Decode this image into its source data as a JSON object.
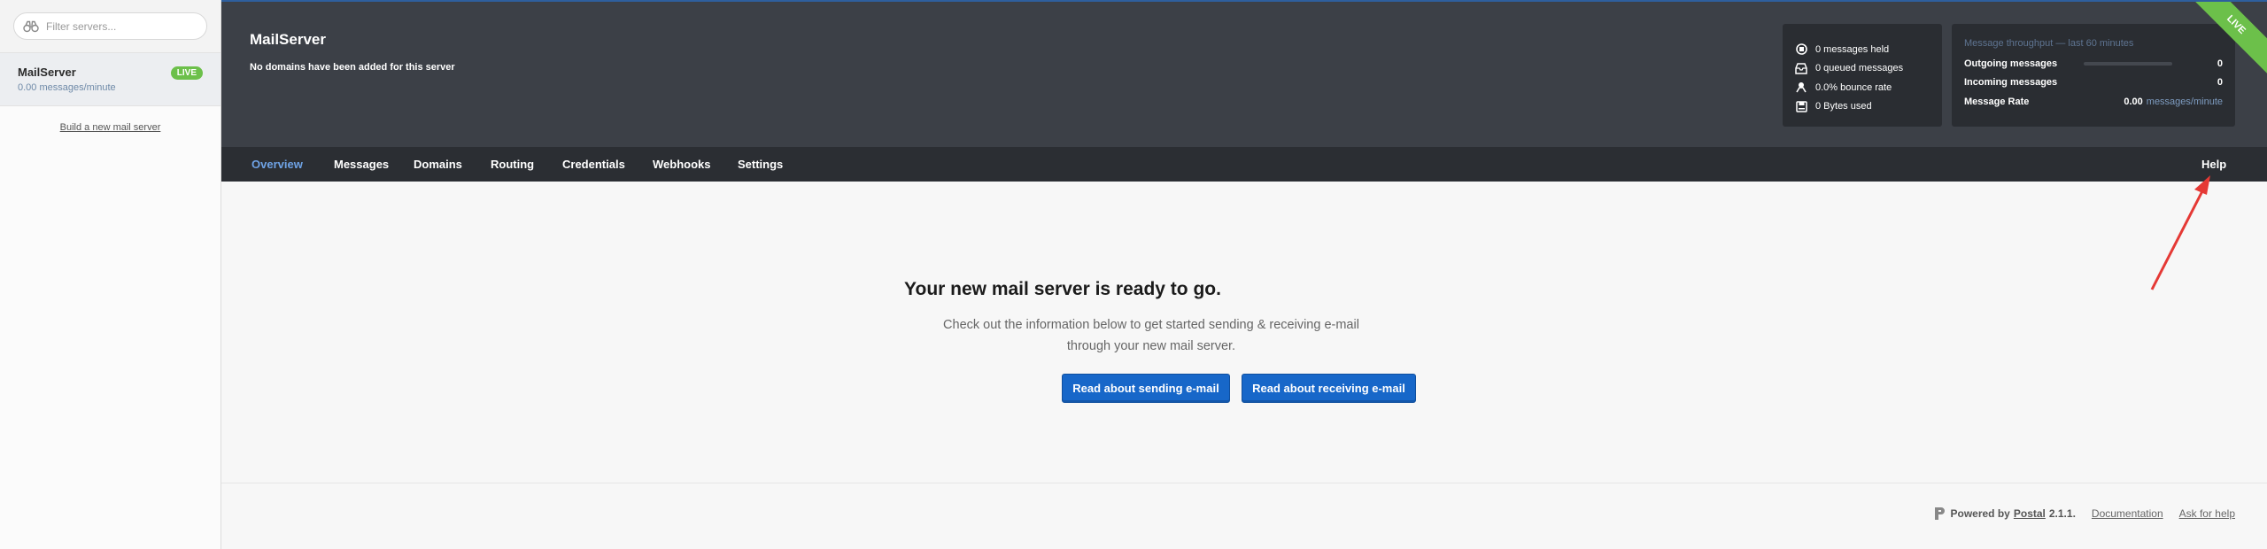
{
  "sidebar": {
    "filter_placeholder": "Filter servers...",
    "server": {
      "name": "MailServer",
      "rate": "0.00 messages/minute",
      "badge": "LIVE"
    },
    "build_link": "Build a new mail server"
  },
  "header": {
    "title": "MailServer",
    "subtitle": "No domains have been added for this server",
    "ribbon": "LIVE",
    "stats": [
      {
        "icon": "held-icon",
        "text": "0 messages held"
      },
      {
        "icon": "queue-icon",
        "text": "0 queued messages"
      },
      {
        "icon": "bounce-icon",
        "text": "0.0% bounce rate"
      },
      {
        "icon": "storage-icon",
        "text": "0 Bytes used"
      }
    ],
    "throughput": {
      "title": "Message throughput — last 60 minutes",
      "outgoing_label": "Outgoing messages",
      "outgoing_value": "0",
      "outgoing_level": 0,
      "incoming_label": "Incoming messages",
      "incoming_value": "0",
      "rate_label": "Message Rate",
      "rate_value": "0.00",
      "rate_unit": "messages/minute"
    }
  },
  "nav": {
    "tabs": [
      "Overview",
      "Messages",
      "Domains",
      "Routing",
      "Credentials",
      "Webhooks",
      "Settings"
    ],
    "active": "Overview",
    "help": "Help"
  },
  "main": {
    "heading": "Your new mail server is ready to go.",
    "text": "Check out the information below to get started sending & receiving e-mail through your new mail server.",
    "btn_send": "Read about sending e-mail",
    "btn_receive": "Read about receiving e-mail"
  },
  "footer": {
    "powered_by": "Powered by",
    "brand": "Postal",
    "version": "2.1.1.",
    "documentation": "Documentation",
    "help": "Ask for help"
  },
  "colors": {
    "header_bg": "#3c4047",
    "nav_bg": "#2b2e33",
    "accent_blue": "#1767c9",
    "live_green": "#6cc04a",
    "annotation_red": "#e53935"
  }
}
